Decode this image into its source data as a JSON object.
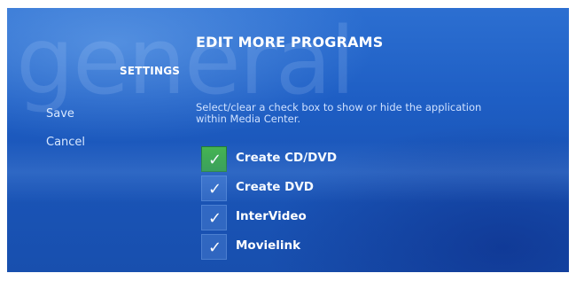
{
  "page": {
    "watermark_text": "general",
    "section_label": "SETTINGS",
    "title": "EDIT MORE PROGRAMS",
    "instructions": "Select/clear a check box to show or hide the application within Media Center."
  },
  "menu": {
    "save_label": "Save",
    "cancel_label": "Cancel"
  },
  "programs": [
    {
      "label": "Create CD/DVD",
      "checked": true,
      "focused": true
    },
    {
      "label": "Create DVD",
      "checked": true,
      "focused": false
    },
    {
      "label": "InterVideo",
      "checked": true,
      "focused": false
    },
    {
      "label": "Movielink",
      "checked": true,
      "focused": false
    }
  ],
  "check_glyph": "✓",
  "colors": {
    "background": "#1e5ec4",
    "focus_green": "#2a9a3a",
    "text_primary": "#ffffff",
    "text_secondary": "#cfe1ff"
  }
}
